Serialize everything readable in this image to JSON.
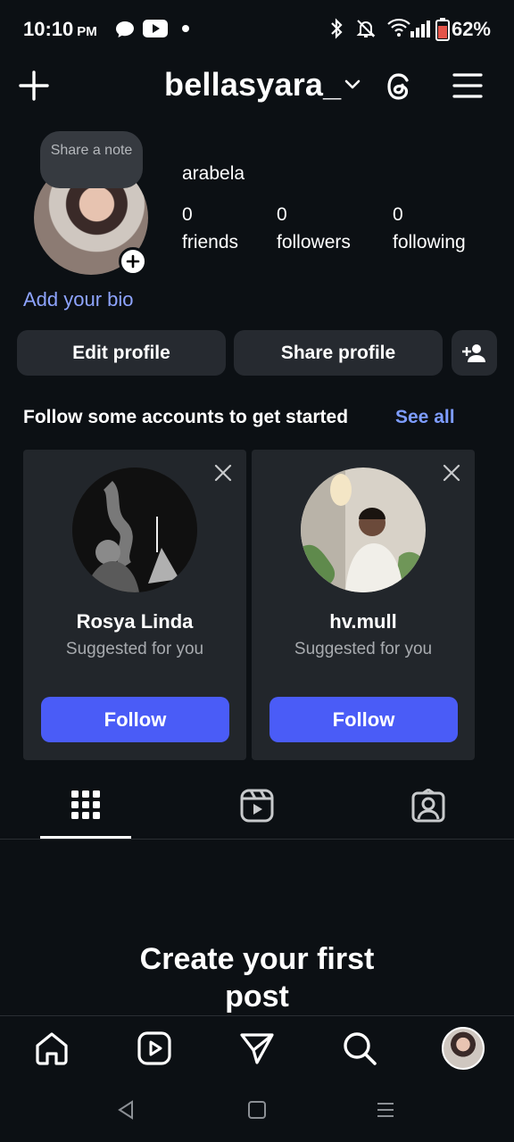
{
  "status_bar": {
    "time": "10:10",
    "ampm": "PM",
    "battery": "62%"
  },
  "header": {
    "username": "bellasyara_"
  },
  "profile": {
    "note": "Share a note",
    "display_name": "arabela",
    "stats": [
      {
        "value": "0",
        "label": "friends"
      },
      {
        "value": "0",
        "label": "followers"
      },
      {
        "value": "0",
        "label": "following"
      }
    ],
    "bio_prompt": "Add your bio"
  },
  "actions": {
    "edit_profile": "Edit profile",
    "share_profile": "Share profile"
  },
  "suggestions": {
    "heading": "Follow some accounts to get started",
    "see_all": "See all",
    "cards": [
      {
        "name": "Rosya Linda",
        "subtitle": "Suggested for you",
        "button": "Follow"
      },
      {
        "name": "hv.mull",
        "subtitle": "Suggested for you",
        "button": "Follow"
      }
    ]
  },
  "tabs": [
    {
      "icon": "grid-icon",
      "active": true
    },
    {
      "icon": "reels-icon",
      "active": false
    },
    {
      "icon": "tagged-icon",
      "active": false
    }
  ],
  "empty_state": {
    "line1": "Create your first",
    "line2": "post"
  },
  "bottom_nav": [
    "home-icon",
    "reels-icon",
    "send-icon",
    "search-icon",
    "profile-avatar"
  ],
  "colors": {
    "background": "#0c1014",
    "accent_button": "#4a5cf7",
    "link": "#8ea4ff"
  }
}
